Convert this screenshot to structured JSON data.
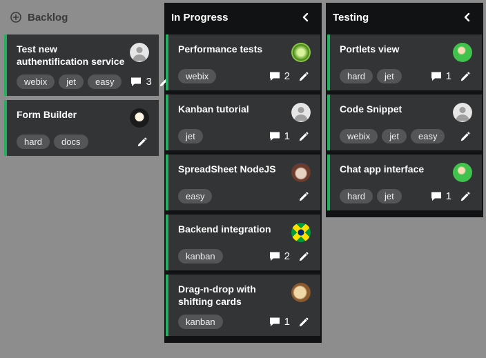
{
  "columns": [
    {
      "key": "backlog",
      "title": "Backlog",
      "style": "muted",
      "addIcon": true,
      "collapsible": false,
      "cards": [
        {
          "title": "Test new authentification service",
          "tags": [
            "webix",
            "jet",
            "easy"
          ],
          "comments": 3,
          "avatar": "default"
        },
        {
          "title": "Form Builder",
          "tags": [
            "hard",
            "docs"
          ],
          "comments": null,
          "avatar": "photo1"
        }
      ]
    },
    {
      "key": "in-progress",
      "title": "In Progress",
      "style": "dark",
      "addIcon": false,
      "collapsible": true,
      "cards": [
        {
          "title": "Performance tests",
          "tags": [
            "webix"
          ],
          "comments": 2,
          "avatar": "green"
        },
        {
          "title": "Kanban tutorial",
          "tags": [
            "jet"
          ],
          "comments": 1,
          "avatar": "default"
        },
        {
          "title": "SpreadSheet NodeJS",
          "tags": [
            "easy"
          ],
          "comments": null,
          "avatar": "dog"
        },
        {
          "title": "Backend integration",
          "tags": [
            "kanban"
          ],
          "comments": 2,
          "avatar": "flag-br"
        },
        {
          "title": "Drag-n-drop with shifting cards",
          "tags": [
            "kanban"
          ],
          "comments": 1,
          "avatar": "wrap"
        }
      ]
    },
    {
      "key": "testing",
      "title": "Testing",
      "style": "dark",
      "addIcon": false,
      "collapsible": true,
      "cards": [
        {
          "title": "Portlets view",
          "tags": [
            "hard",
            "jet"
          ],
          "comments": 1,
          "avatar": "anime"
        },
        {
          "title": "Code Snippet",
          "tags": [
            "webix",
            "jet",
            "easy"
          ],
          "comments": null,
          "avatar": "default"
        },
        {
          "title": "Chat app interface",
          "tags": [
            "hard",
            "jet"
          ],
          "comments": 1,
          "avatar": "anime"
        }
      ]
    }
  ]
}
